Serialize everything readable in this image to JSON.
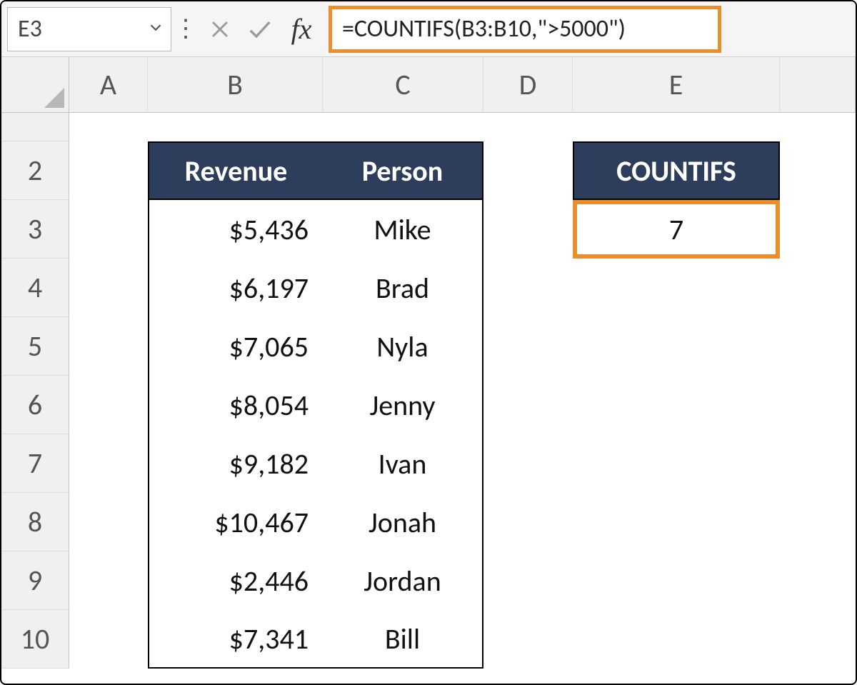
{
  "name_box": "E3",
  "formula": "=COUNTIFS(B3:B10,\">5000\")",
  "fx_label": "fx",
  "columns": [
    "A",
    "B",
    "C",
    "D",
    "E"
  ],
  "rows_visible": [
    "2",
    "3",
    "4",
    "5",
    "6",
    "7",
    "8",
    "9",
    "10"
  ],
  "table": {
    "headers": {
      "revenue": "Revenue",
      "person": "Person"
    },
    "rows": [
      {
        "revenue": "$5,436",
        "person": "Mike"
      },
      {
        "revenue": "$6,197",
        "person": "Brad"
      },
      {
        "revenue": "$7,065",
        "person": "Nyla"
      },
      {
        "revenue": "$8,054",
        "person": "Jenny"
      },
      {
        "revenue": "$9,182",
        "person": "Ivan"
      },
      {
        "revenue": "$10,467",
        "person": "Jonah"
      },
      {
        "revenue": "$2,446",
        "person": "Jordan"
      },
      {
        "revenue": "$7,341",
        "person": "Bill"
      }
    ]
  },
  "countifs": {
    "header": "COUNTIFS",
    "value": "7"
  }
}
